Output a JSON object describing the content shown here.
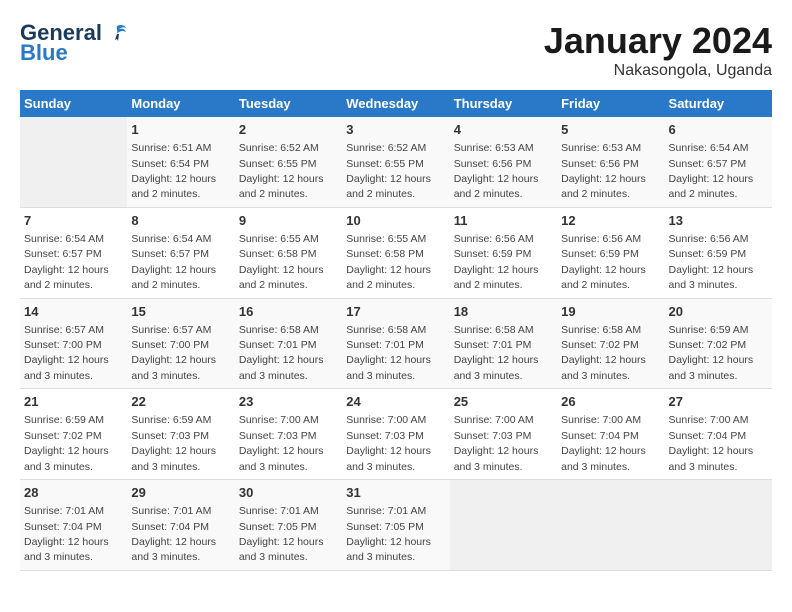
{
  "header": {
    "logo_line1": "General",
    "logo_line2": "Blue",
    "title": "January 2024",
    "subtitle": "Nakasongola, Uganda"
  },
  "columns": [
    "Sunday",
    "Monday",
    "Tuesday",
    "Wednesday",
    "Thursday",
    "Friday",
    "Saturday"
  ],
  "weeks": [
    [
      {
        "day": "",
        "info": ""
      },
      {
        "day": "1",
        "info": "Sunrise: 6:51 AM\nSunset: 6:54 PM\nDaylight: 12 hours\nand 2 minutes."
      },
      {
        "day": "2",
        "info": "Sunrise: 6:52 AM\nSunset: 6:55 PM\nDaylight: 12 hours\nand 2 minutes."
      },
      {
        "day": "3",
        "info": "Sunrise: 6:52 AM\nSunset: 6:55 PM\nDaylight: 12 hours\nand 2 minutes."
      },
      {
        "day": "4",
        "info": "Sunrise: 6:53 AM\nSunset: 6:56 PM\nDaylight: 12 hours\nand 2 minutes."
      },
      {
        "day": "5",
        "info": "Sunrise: 6:53 AM\nSunset: 6:56 PM\nDaylight: 12 hours\nand 2 minutes."
      },
      {
        "day": "6",
        "info": "Sunrise: 6:54 AM\nSunset: 6:57 PM\nDaylight: 12 hours\nand 2 minutes."
      }
    ],
    [
      {
        "day": "7",
        "info": "Sunrise: 6:54 AM\nSunset: 6:57 PM\nDaylight: 12 hours\nand 2 minutes."
      },
      {
        "day": "8",
        "info": "Sunrise: 6:54 AM\nSunset: 6:57 PM\nDaylight: 12 hours\nand 2 minutes."
      },
      {
        "day": "9",
        "info": "Sunrise: 6:55 AM\nSunset: 6:58 PM\nDaylight: 12 hours\nand 2 minutes."
      },
      {
        "day": "10",
        "info": "Sunrise: 6:55 AM\nSunset: 6:58 PM\nDaylight: 12 hours\nand 2 minutes."
      },
      {
        "day": "11",
        "info": "Sunrise: 6:56 AM\nSunset: 6:59 PM\nDaylight: 12 hours\nand 2 minutes."
      },
      {
        "day": "12",
        "info": "Sunrise: 6:56 AM\nSunset: 6:59 PM\nDaylight: 12 hours\nand 2 minutes."
      },
      {
        "day": "13",
        "info": "Sunrise: 6:56 AM\nSunset: 6:59 PM\nDaylight: 12 hours\nand 3 minutes."
      }
    ],
    [
      {
        "day": "14",
        "info": "Sunrise: 6:57 AM\nSunset: 7:00 PM\nDaylight: 12 hours\nand 3 minutes."
      },
      {
        "day": "15",
        "info": "Sunrise: 6:57 AM\nSunset: 7:00 PM\nDaylight: 12 hours\nand 3 minutes."
      },
      {
        "day": "16",
        "info": "Sunrise: 6:58 AM\nSunset: 7:01 PM\nDaylight: 12 hours\nand 3 minutes."
      },
      {
        "day": "17",
        "info": "Sunrise: 6:58 AM\nSunset: 7:01 PM\nDaylight: 12 hours\nand 3 minutes."
      },
      {
        "day": "18",
        "info": "Sunrise: 6:58 AM\nSunset: 7:01 PM\nDaylight: 12 hours\nand 3 minutes."
      },
      {
        "day": "19",
        "info": "Sunrise: 6:58 AM\nSunset: 7:02 PM\nDaylight: 12 hours\nand 3 minutes."
      },
      {
        "day": "20",
        "info": "Sunrise: 6:59 AM\nSunset: 7:02 PM\nDaylight: 12 hours\nand 3 minutes."
      }
    ],
    [
      {
        "day": "21",
        "info": "Sunrise: 6:59 AM\nSunset: 7:02 PM\nDaylight: 12 hours\nand 3 minutes."
      },
      {
        "day": "22",
        "info": "Sunrise: 6:59 AM\nSunset: 7:03 PM\nDaylight: 12 hours\nand 3 minutes."
      },
      {
        "day": "23",
        "info": "Sunrise: 7:00 AM\nSunset: 7:03 PM\nDaylight: 12 hours\nand 3 minutes."
      },
      {
        "day": "24",
        "info": "Sunrise: 7:00 AM\nSunset: 7:03 PM\nDaylight: 12 hours\nand 3 minutes."
      },
      {
        "day": "25",
        "info": "Sunrise: 7:00 AM\nSunset: 7:03 PM\nDaylight: 12 hours\nand 3 minutes."
      },
      {
        "day": "26",
        "info": "Sunrise: 7:00 AM\nSunset: 7:04 PM\nDaylight: 12 hours\nand 3 minutes."
      },
      {
        "day": "27",
        "info": "Sunrise: 7:00 AM\nSunset: 7:04 PM\nDaylight: 12 hours\nand 3 minutes."
      }
    ],
    [
      {
        "day": "28",
        "info": "Sunrise: 7:01 AM\nSunset: 7:04 PM\nDaylight: 12 hours\nand 3 minutes."
      },
      {
        "day": "29",
        "info": "Sunrise: 7:01 AM\nSunset: 7:04 PM\nDaylight: 12 hours\nand 3 minutes."
      },
      {
        "day": "30",
        "info": "Sunrise: 7:01 AM\nSunset: 7:05 PM\nDaylight: 12 hours\nand 3 minutes."
      },
      {
        "day": "31",
        "info": "Sunrise: 7:01 AM\nSunset: 7:05 PM\nDaylight: 12 hours\nand 3 minutes."
      },
      {
        "day": "",
        "info": ""
      },
      {
        "day": "",
        "info": ""
      },
      {
        "day": "",
        "info": ""
      }
    ]
  ]
}
